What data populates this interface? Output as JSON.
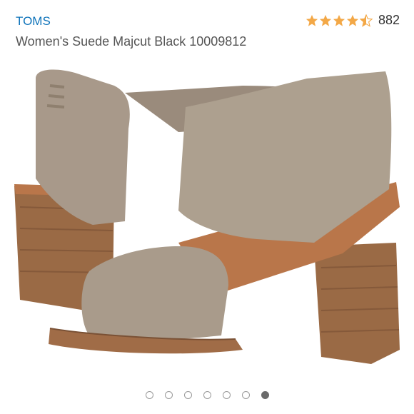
{
  "header": {
    "brand": "TOMS",
    "title": "Women's Suede Majcut Black 10009812"
  },
  "rating": {
    "stars": 4.5,
    "count": "882",
    "color": "#f3a847"
  },
  "carousel": {
    "total": 7,
    "active_index": 6
  },
  "colors": {
    "brand_link": "#0e73ba",
    "suede": "#a8998a",
    "heel_wood": "#9a6a45",
    "insole": "#b9764a"
  }
}
